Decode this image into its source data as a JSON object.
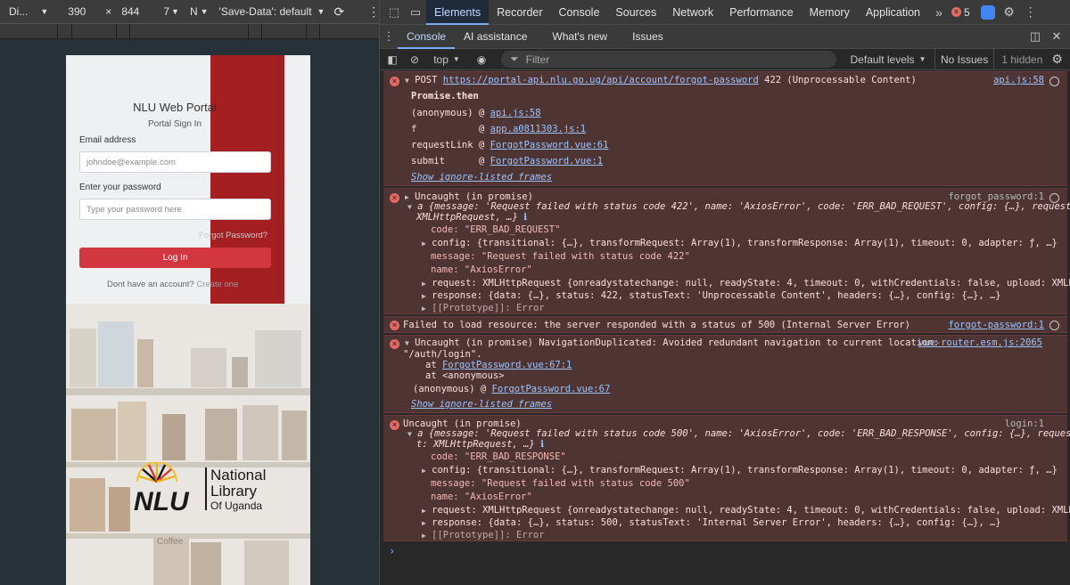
{
  "device_toolbar": {
    "device": "Di...",
    "width": "390",
    "times": "×",
    "height": "844",
    "dpr": "7",
    "throttle": "N",
    "save_data": "'Save-Data': default",
    "more": "⋮"
  },
  "login_page": {
    "title": "NLU Web Portal",
    "subtitle": "Portal Sign In",
    "email_label": "Email address",
    "email_placeholder": "johndoe@example.com",
    "password_label": "Enter your password",
    "password_placeholder": "Type your password here",
    "forgot_link": "Forgot Password?",
    "login_button": "Log In",
    "no_account_text": "Dont have an account?",
    "create_link": "Create one",
    "logo_text": {
      "short": "NLU",
      "line1": "National",
      "line2": "Library",
      "line3": "Of Uganda"
    },
    "bottom_sign": "Coffee"
  },
  "devtools": {
    "tabs": [
      "Elements",
      "Recorder",
      "Console",
      "Sources",
      "Network",
      "Performance",
      "Memory",
      "Application"
    ],
    "active_tab": "Elements",
    "error_count": "5",
    "drawer_tabs": [
      "Console",
      "AI assistance",
      "What's new",
      "Issues"
    ],
    "active_drawer": "Console",
    "context": "top",
    "filter_placeholder": "Filter",
    "levels": "Default levels",
    "issues": "No Issues",
    "hidden": "1 hidden"
  },
  "console": {
    "m1": {
      "head_prefix": "POST",
      "url": "https://portal-api.nlu.go.ug/api/account/forgot-password",
      "status": "422 (Unprocessable Content)",
      "source": "api.js:58",
      "promise": "Promise.then",
      "frames": [
        {
          "fn": "(anonymous)",
          "at": "@",
          "loc": "api.js:58"
        },
        {
          "fn": "f",
          "at": "@",
          "loc": "app.a0811303.js:1"
        },
        {
          "fn": "requestLink",
          "at": "@",
          "loc": "ForgotPassword.vue:61"
        },
        {
          "fn": "submit",
          "at": "@",
          "loc": "ForgotPassword.vue:1"
        }
      ],
      "show_frames": "Show ignore-listed frames"
    },
    "m2": {
      "head": "Uncaught (in promise)",
      "source": "forgot_password:1",
      "summary1": "a {message: 'Request failed with status code 422', name: 'AxiosError', code: 'ERR_BAD_REQUEST', config: {…}, request:",
      "summary2": "XMLHttpRequest, …}",
      "code": "code: \"ERR_BAD_REQUEST\"",
      "config": "config: {transitional: {…}, transformRequest: Array(1), transformResponse: Array(1), timeout: 0, adapter: ƒ, …}",
      "message": "message: \"Request failed with status code 422\"",
      "name": "name: \"AxiosError\"",
      "request": "request: XMLHttpRequest {onreadystatechange: null, readyState: 4, timeout: 0, withCredentials: false, upload: XMLHtt",
      "response": "response: {data: {…}, status: 422, statusText: 'Unprocessable Content', headers: {…}, config: {…}, …}",
      "proto": "[[Prototype]]: Error"
    },
    "m3": {
      "text": "Failed to load resource: the server responded with a status of 500 (Internal Server Error)",
      "source": "forgot-password:1"
    },
    "m4": {
      "head": "Uncaught (in promise) NavigationDuplicated: Avoided redundant navigation to current location:",
      "head2": "\"/auth/login\".",
      "source": "vue-router.esm.js:2065",
      "at1_prefix": "at",
      "at1_loc": "ForgotPassword.vue:67:1",
      "at2": "at <anonymous>",
      "anon_prefix": "(anonymous) @",
      "anon_loc": "ForgotPassword.vue:67",
      "show_frames": "Show ignore-listed frames"
    },
    "m5": {
      "head": "Uncaught (in promise)",
      "source": "login:1",
      "summary1": "a {message: 'Request failed with status code 500', name: 'AxiosError', code: 'ERR_BAD_RESPONSE', config: {…}, reques",
      "summary2": "t: XMLHttpRequest, …}",
      "code": "code: \"ERR_BAD_RESPONSE\"",
      "config": "config: {transitional: {…}, transformRequest: Array(1), transformResponse: Array(1), timeout: 0, adapter: ƒ, …}",
      "message": "message: \"Request failed with status code 500\"",
      "name": "name: \"AxiosError\"",
      "request": "request: XMLHttpRequest {onreadystatechange: null, readyState: 4, timeout: 0, withCredentials: false, upload: XMLHtt",
      "response": "response: {data: {…}, status: 500, statusText: 'Internal Server Error', headers: {…}, config: {…}, …}",
      "proto": "[[Prototype]]: Error"
    },
    "prompt": "›"
  }
}
